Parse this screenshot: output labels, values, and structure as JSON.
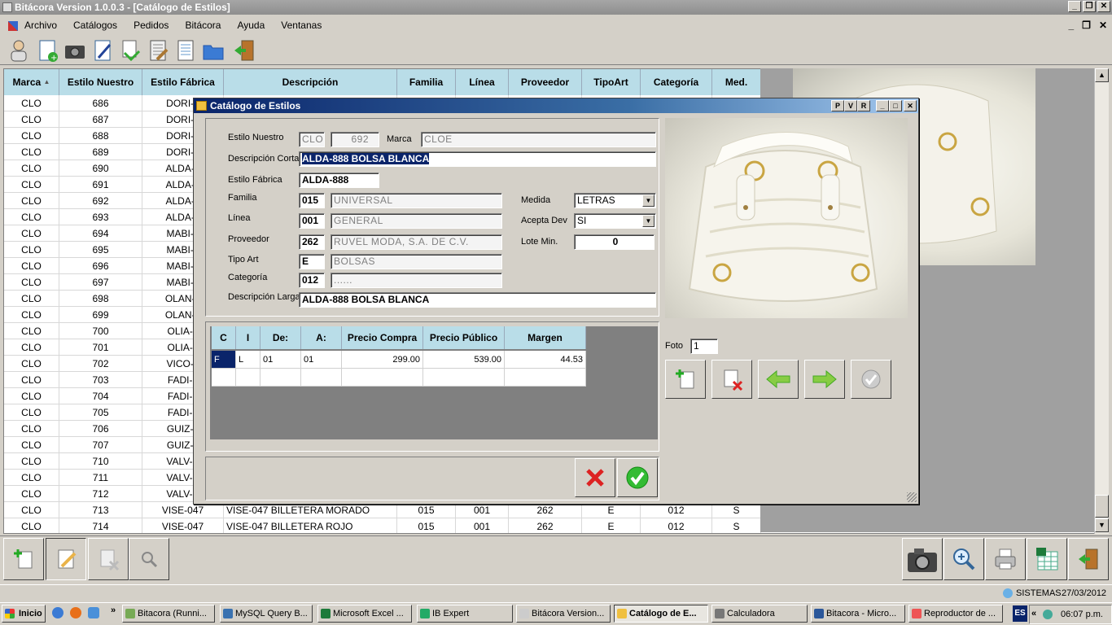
{
  "app": {
    "title": "Bitácora Version 1.0.0.3 - [Catálogo de Estilos]"
  },
  "menu": [
    "Archivo",
    "Catálogos",
    "Pedidos",
    "Bitácora",
    "Ayuda",
    "Ventanas"
  ],
  "toolbar_icons": [
    "user-icon",
    "new-doc-icon",
    "camera-icon",
    "edit-doc-icon",
    "import-icon",
    "notebook-icon",
    "report-icon",
    "folder-icon",
    "exit-door-icon"
  ],
  "grid": {
    "headers": [
      "Marca",
      "Estilo Nuestro",
      "Estilo Fábrica",
      "Descripción",
      "Familia",
      "Línea",
      "Proveedor",
      "TipoArt",
      "Categoría",
      "Med."
    ],
    "rows": [
      [
        "CLO",
        "686",
        "DORI-6",
        "",
        "",
        "",
        "",
        "",
        "",
        ""
      ],
      [
        "CLO",
        "687",
        "DORI-6",
        "",
        "",
        "",
        "",
        "",
        "",
        ""
      ],
      [
        "CLO",
        "688",
        "DORI-6",
        "",
        "",
        "",
        "",
        "",
        "",
        ""
      ],
      [
        "CLO",
        "689",
        "DORI-6",
        "",
        "",
        "",
        "",
        "",
        "",
        ""
      ],
      [
        "CLO",
        "690",
        "ALDA-8",
        "",
        "",
        "",
        "",
        "",
        "",
        ""
      ],
      [
        "CLO",
        "691",
        "ALDA-8",
        "",
        "",
        "",
        "",
        "",
        "",
        ""
      ],
      [
        "CLO",
        "692",
        "ALDA-8",
        "",
        "",
        "",
        "",
        "",
        "",
        ""
      ],
      [
        "CLO",
        "693",
        "ALDA-8",
        "",
        "",
        "",
        "",
        "",
        "",
        ""
      ],
      [
        "CLO",
        "694",
        "MABI-9",
        "",
        "",
        "",
        "",
        "",
        "",
        ""
      ],
      [
        "CLO",
        "695",
        "MABI-9",
        "",
        "",
        "",
        "",
        "",
        "",
        ""
      ],
      [
        "CLO",
        "696",
        "MABI-9",
        "",
        "",
        "",
        "",
        "",
        "",
        ""
      ],
      [
        "CLO",
        "697",
        "MABI-9",
        "",
        "",
        "",
        "",
        "",
        "",
        ""
      ],
      [
        "CLO",
        "698",
        "OLAN-1",
        "",
        "",
        "",
        "",
        "",
        "",
        ""
      ],
      [
        "CLO",
        "699",
        "OLAN-1",
        "",
        "",
        "",
        "",
        "",
        "",
        ""
      ],
      [
        "CLO",
        "700",
        "OLIA-0",
        "",
        "",
        "",
        "",
        "",
        "",
        ""
      ],
      [
        "CLO",
        "701",
        "OLIA-0",
        "",
        "",
        "",
        "",
        "",
        "",
        ""
      ],
      [
        "CLO",
        "702",
        "VICO-9",
        "",
        "",
        "",
        "",
        "",
        "",
        ""
      ],
      [
        "CLO",
        "703",
        "FADI-9",
        "",
        "",
        "",
        "",
        "",
        "",
        ""
      ],
      [
        "CLO",
        "704",
        "FADI-9",
        "",
        "",
        "",
        "",
        "",
        "",
        ""
      ],
      [
        "CLO",
        "705",
        "FADI-9",
        "",
        "",
        "",
        "",
        "",
        "",
        ""
      ],
      [
        "CLO",
        "706",
        "GUIZ-9",
        "",
        "",
        "",
        "",
        "",
        "",
        ""
      ],
      [
        "CLO",
        "707",
        "GUIZ-9",
        "",
        "",
        "",
        "",
        "",
        "",
        ""
      ],
      [
        "CLO",
        "710",
        "VALV-S",
        "",
        "",
        "",
        "",
        "",
        "",
        ""
      ],
      [
        "CLO",
        "711",
        "VALV-S",
        "",
        "",
        "",
        "",
        "",
        "",
        ""
      ],
      [
        "CLO",
        "712",
        "VALV-S",
        "",
        "",
        "",
        "",
        "",
        "",
        ""
      ],
      [
        "CLO",
        "713",
        "VISE-047",
        "VISE-047 BILLETERA MORADO",
        "015",
        "001",
        "262",
        "E",
        "012",
        "S"
      ],
      [
        "CLO",
        "714",
        "VISE-047",
        "VISE-047 BILLETERA ROJO",
        "015",
        "001",
        "262",
        "E",
        "012",
        "S"
      ]
    ]
  },
  "dialog": {
    "title": "Catálogo de Estilos",
    "title_buttons": [
      "P",
      "V",
      "R"
    ],
    "labels": {
      "estilo_nuestro": "Estilo Nuestro",
      "marca": "Marca",
      "desc_corta": "Descripción Corta",
      "estilo_fabrica": "Estilo Fábrica",
      "familia": "Familia",
      "linea": "Línea",
      "proveedor": "Proveedor",
      "tipo_art": "Tipo Art",
      "categoria": "Categoría",
      "desc_larga": "Descripción Larga",
      "medida": "Medida",
      "acepta_dev": "Acepta Dev",
      "lote_min": "Lote Min.",
      "foto": "Foto"
    },
    "values": {
      "marca_code": "CLO",
      "estilo_num": "692",
      "marca_name": "CLOE",
      "desc_corta": "ALDA-888 BOLSA BLANCA",
      "estilo_fabrica": "ALDA-888",
      "familia_code": "015",
      "familia_name": "UNIVERSAL",
      "linea_code": "001",
      "linea_name": "GENERAL",
      "proveedor_code": "262",
      "proveedor_name": "RUVEL MODA, S.A. DE C.V.",
      "tipo_code": "E",
      "tipo_name": "BOLSAS",
      "categoria_code": "012",
      "categoria_name": "......",
      "desc_larga": "ALDA-888 BOLSA BLANCA",
      "medida": "LETRAS",
      "acepta_dev": "SI",
      "lote_min": "0",
      "foto": "1"
    },
    "prices": {
      "headers": [
        "C",
        "I",
        "De:",
        "A:",
        "Precio Compra",
        "Precio Público",
        "Margen"
      ],
      "rows": [
        [
          "F",
          "L",
          "01",
          "01",
          "299.00",
          "539.00",
          "44.53"
        ]
      ]
    }
  },
  "status": {
    "user": "SISTEMAS",
    "date": "27/03/2012"
  },
  "taskbar": {
    "start": "Inicio",
    "tasks": [
      "Bitacora (Runni...",
      "MySQL Query B...",
      "Microsoft Excel ...",
      "IB Expert",
      "Bitácora Version...",
      "Catálogo de E...",
      "Calculadora",
      "Bitacora - Micro...",
      "Reproductor de ..."
    ],
    "lang": "ES",
    "time": "06:07 p.m."
  }
}
